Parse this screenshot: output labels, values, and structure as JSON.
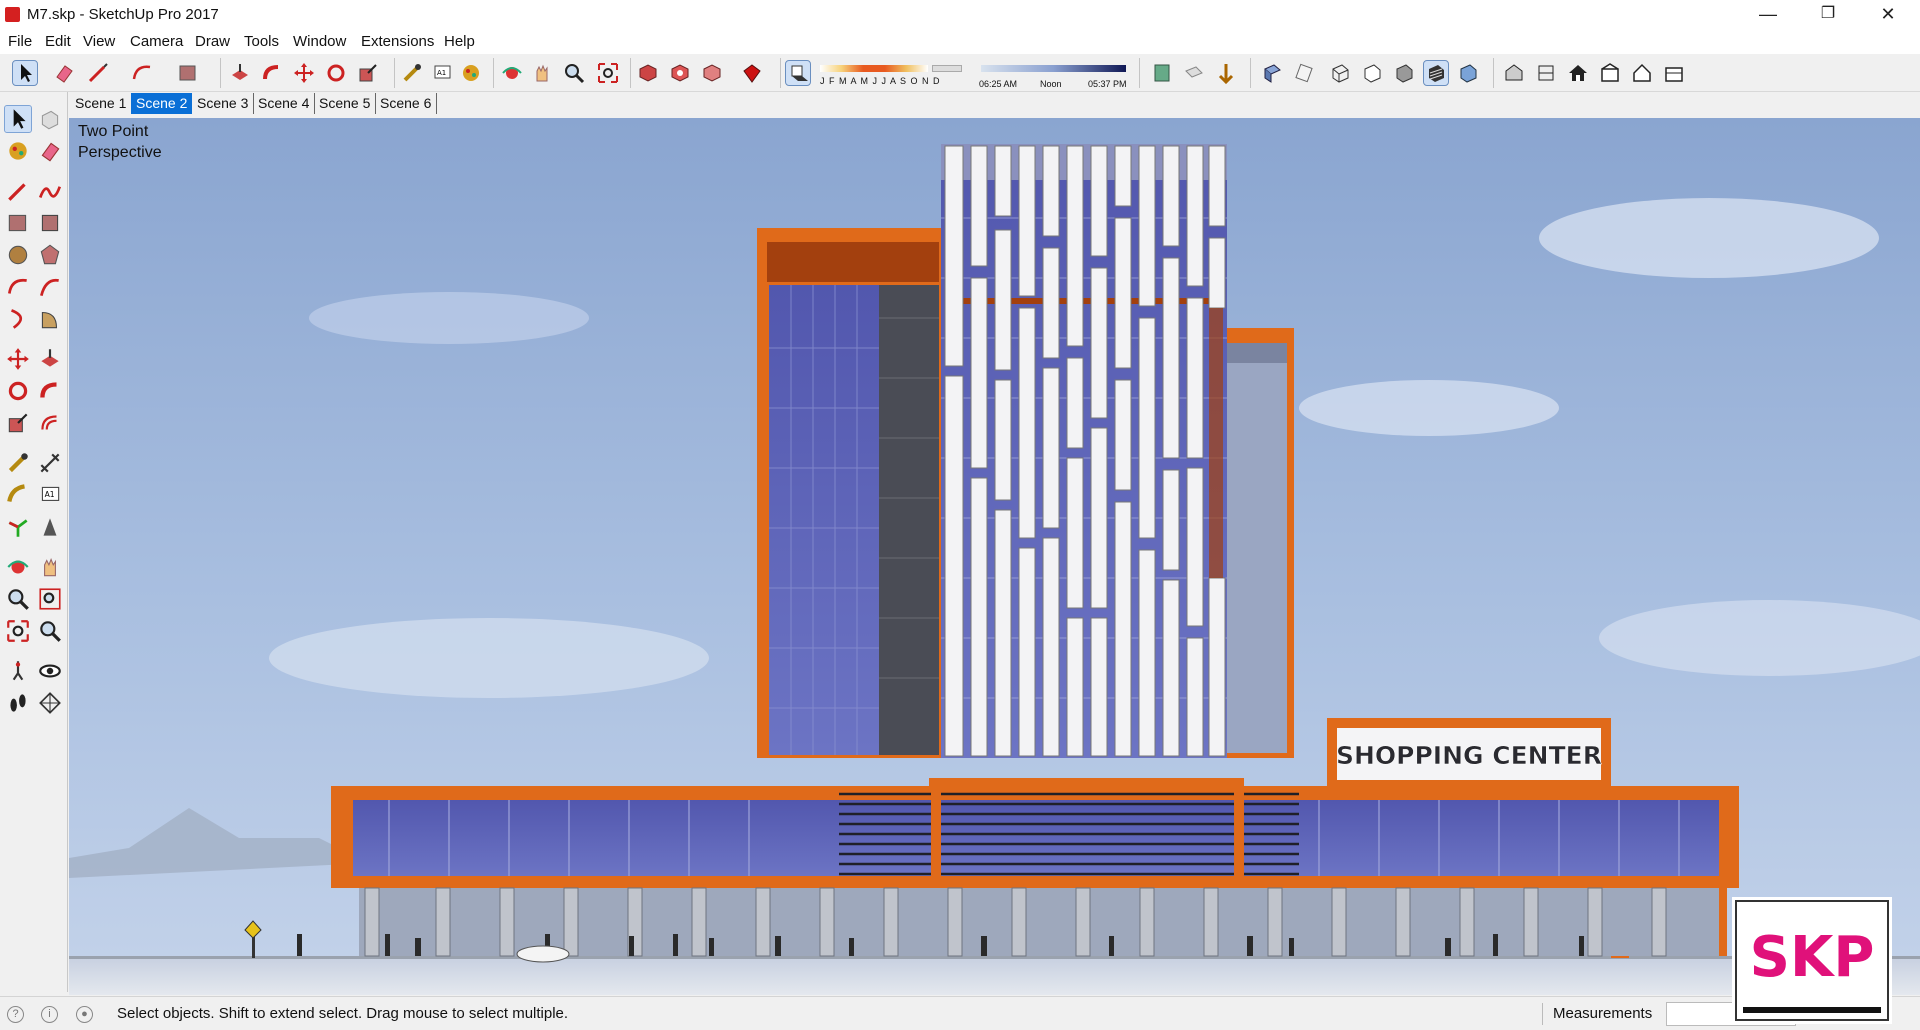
{
  "window": {
    "title": "M7.skp - SketchUp Pro 2017",
    "minimize": "—",
    "restore": "❐",
    "close": "✕"
  },
  "menu": [
    "File",
    "Edit",
    "View",
    "Camera",
    "Draw",
    "Tools",
    "Window",
    "Extensions",
    "Help"
  ],
  "shadow": {
    "months": "J F M A M J J A S O N D",
    "sunrise": "06:25 AM",
    "noon": "Noon",
    "sunset": "05:37 PM"
  },
  "scenes": [
    {
      "label": "Scene 1",
      "active": false
    },
    {
      "label": "Scene 2",
      "active": true
    },
    {
      "label": "Scene 3",
      "active": false
    },
    {
      "label": "Scene 4",
      "active": false
    },
    {
      "label": "Scene 5",
      "active": false
    },
    {
      "label": "Scene 6",
      "active": false
    }
  ],
  "viewport": {
    "camera_line1": "Two Point",
    "camera_line2": "Perspective",
    "sign": "SHOPPING CENTER"
  },
  "colors": {
    "accent": "#0a6fd6",
    "frame_orange": "#e06a1a",
    "glass": "#5a60b4",
    "sky": "#9db4da",
    "skp_badge": "#e0117a"
  },
  "status": {
    "message": "Select objects. Shift to extend select. Drag mouse to select multiple.",
    "measurements_label": "Measurements",
    "measurements_value": ""
  },
  "badge": {
    "text": "SKP"
  }
}
